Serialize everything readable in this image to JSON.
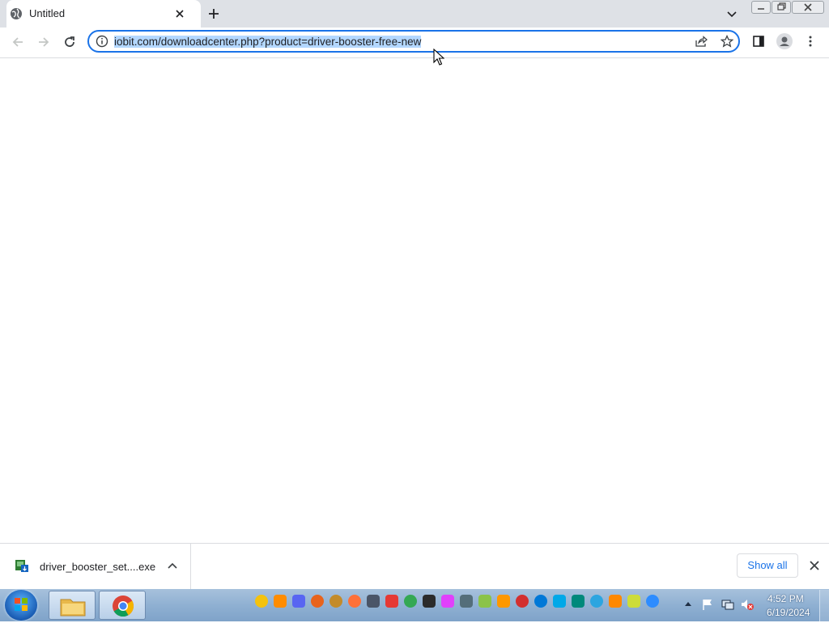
{
  "browser": {
    "tab_title": "Untitled",
    "url": "iobit.com/downloadcenter.php?product=driver-booster-free-new"
  },
  "download_shelf": {
    "file_name": "driver_booster_set....exe",
    "show_all_label": "Show all"
  },
  "taskbar": {
    "time": "4:52 PM",
    "date": "6/19/2024"
  },
  "colors": {
    "accent": "#1a73e8",
    "selection": "#b3d7ff",
    "tabstrip": "#dee1e6"
  }
}
